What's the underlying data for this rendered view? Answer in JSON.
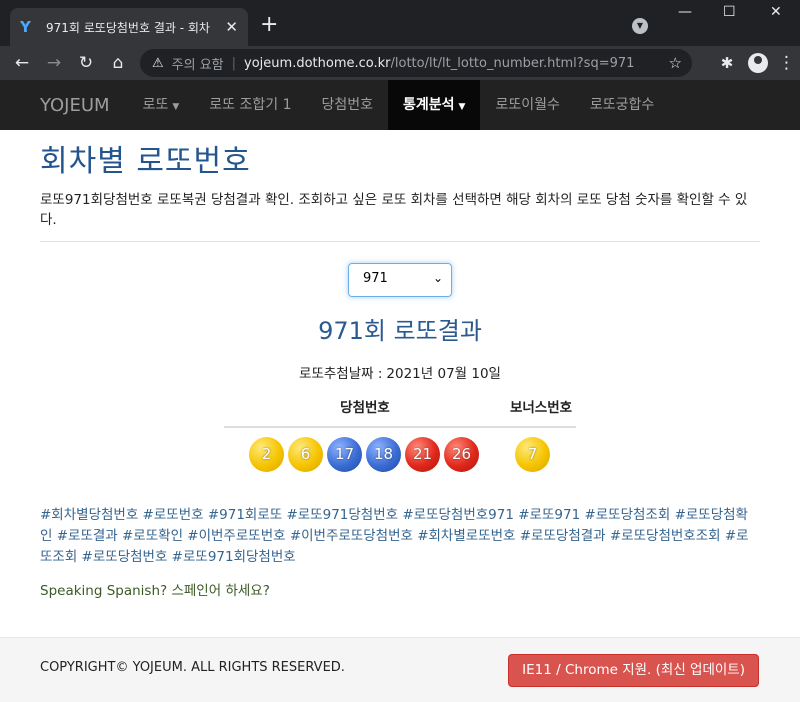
{
  "browser": {
    "tab_title": "971회 로또당첨번호 결과 - 회차",
    "tab_close": "✕",
    "new_tab": "+",
    "not_secure": "주의 요함",
    "url_host": "yojeum.dothome.co.kr",
    "url_path": "/lotto/lt/lt_lotto_number.html?sq=971"
  },
  "nav": {
    "brand": "YOJEUM",
    "items": [
      {
        "label": "로또",
        "caret": true,
        "active": false
      },
      {
        "label": "로또 조합기 1",
        "caret": false,
        "active": false
      },
      {
        "label": "당첨번호",
        "caret": false,
        "active": false
      },
      {
        "label": "통계분석",
        "caret": true,
        "active": true
      },
      {
        "label": "로또이월수",
        "caret": false,
        "active": false
      },
      {
        "label": "로또궁합수",
        "caret": false,
        "active": false
      }
    ]
  },
  "page": {
    "title": "회차별 로또번호",
    "description": "로또971회당첨번호 로또복권 당첨결과 확인. 조회하고 싶은 로또 회차를 선택하면 해당 회차의 로또 당첨 숫자를 확인할 수 있다.",
    "select_value": "971",
    "result_title": "971회 로또결과",
    "draw_date_label": "로또추첨날짜 :",
    "draw_date": "2021년 07월 10일",
    "winning_header": "당첨번호",
    "bonus_header": "보너스번호",
    "tags": "#회차별당첨번호 #로또번호 #971회로또 #로또971당첨번호 #로또당첨번호971 #로또971 #로또당첨조회 #로또당첨확인 #로또결과 #로또확인 #이번주로또번호 #이번주로또당첨번호 #회차별로또번호 #로또당첨결과 #로또당첨번호조회 #로또조회 #로또당첨번호 #로또971회당첨번호",
    "spanish_link": "Speaking Spanish? 스페인어 하세요?"
  },
  "balls": {
    "winning": [
      {
        "number": "2",
        "color": "yellow"
      },
      {
        "number": "6",
        "color": "yellow"
      },
      {
        "number": "17",
        "color": "blue"
      },
      {
        "number": "18",
        "color": "blue"
      },
      {
        "number": "21",
        "color": "red"
      },
      {
        "number": "26",
        "color": "red"
      }
    ],
    "bonus": {
      "number": "7",
      "color": "yellow"
    }
  },
  "footer": {
    "copyright": "COPYRIGHT© YOJEUM. ALL RIGHTS RESERVED.",
    "button": "IE11 / Chrome 지원. (최신 업데이트)"
  }
}
